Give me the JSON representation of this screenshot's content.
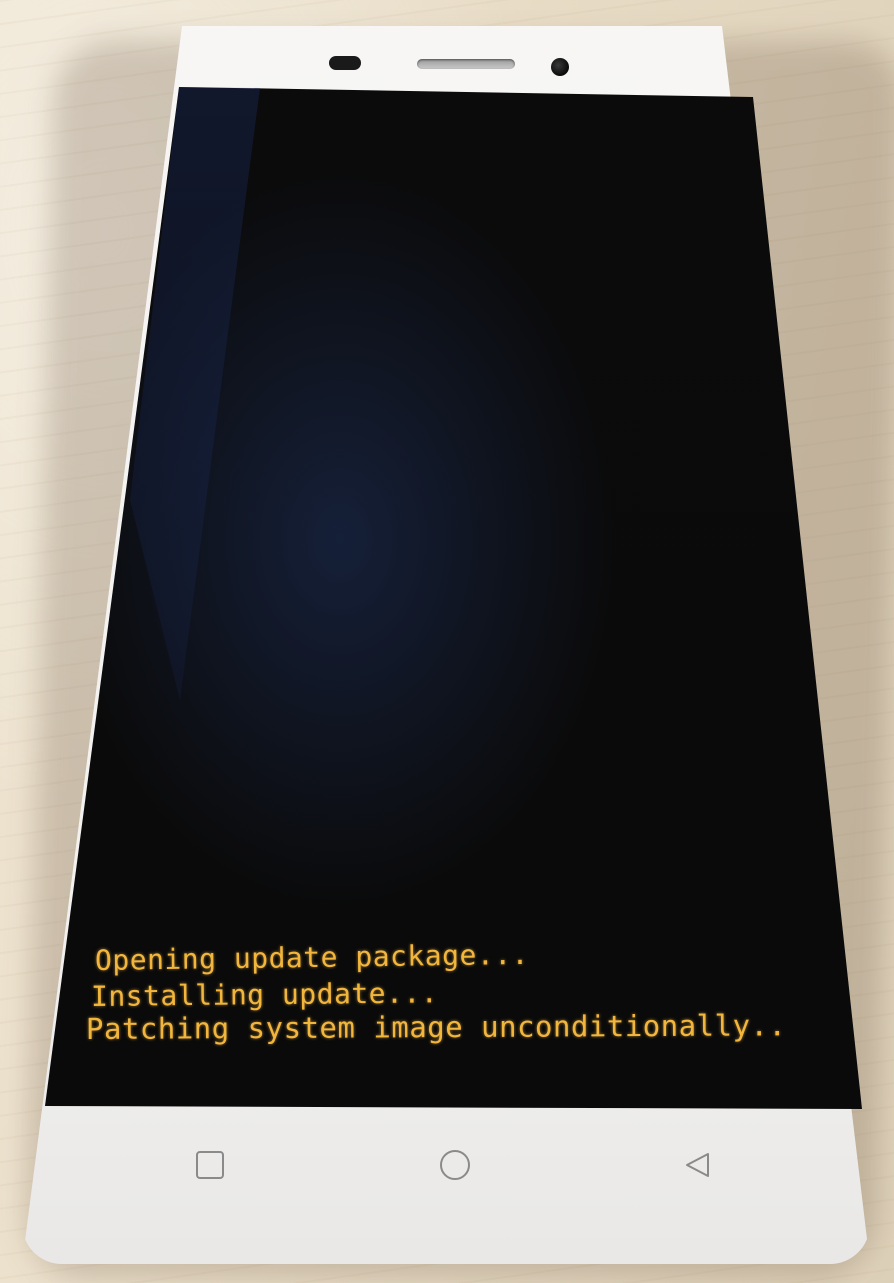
{
  "screen": {
    "log_lines": [
      "Opening update package...",
      "Installing update...",
      "Patching system image unconditionally.."
    ],
    "text_color": "#f2b63c",
    "background_color": "#0a0a0a"
  },
  "device": {
    "body_color": "#f4f3f1",
    "nav_buttons": [
      {
        "name": "recent-apps",
        "icon": "square-icon"
      },
      {
        "name": "home",
        "icon": "circle-icon"
      },
      {
        "name": "back",
        "icon": "triangle-left-icon"
      }
    ]
  }
}
